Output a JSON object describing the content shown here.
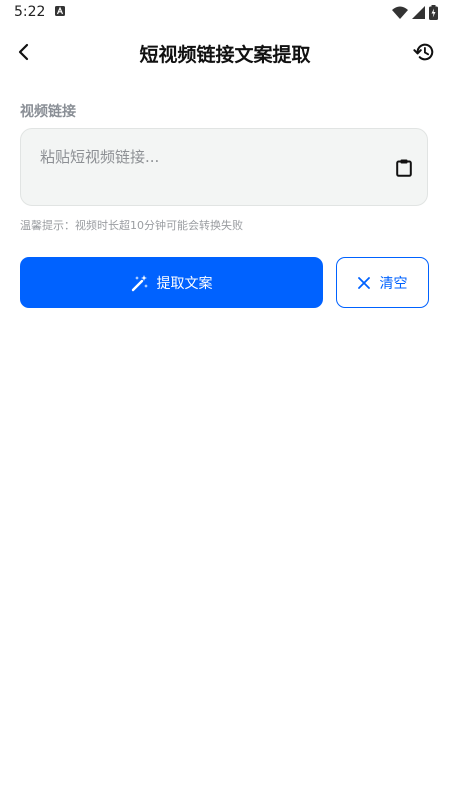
{
  "status_bar": {
    "time": "5:22",
    "notification_icon": "a-icon",
    "wifi_icon": "wifi-icon",
    "signal_icon": "signal-icon",
    "battery_icon": "battery-charging-icon"
  },
  "app_bar": {
    "title": "短视频链接文案提取",
    "back_icon": "chevron-left-icon",
    "history_icon": "history-icon"
  },
  "form": {
    "label": "视频链接",
    "input_value": "",
    "input_placeholder": "粘贴短视频链接...",
    "paste_icon": "clipboard-icon",
    "tip": "温馨提示：视频时长超10分钟可能会转换失败"
  },
  "actions": {
    "extract_label": "提取文案",
    "extract_icon": "magic-wand-icon",
    "clear_label": "清空",
    "clear_icon": "close-icon"
  },
  "colors": {
    "accent": "#0062ff",
    "input_bg": "#f3f5f4",
    "label": "#8a8f96"
  }
}
